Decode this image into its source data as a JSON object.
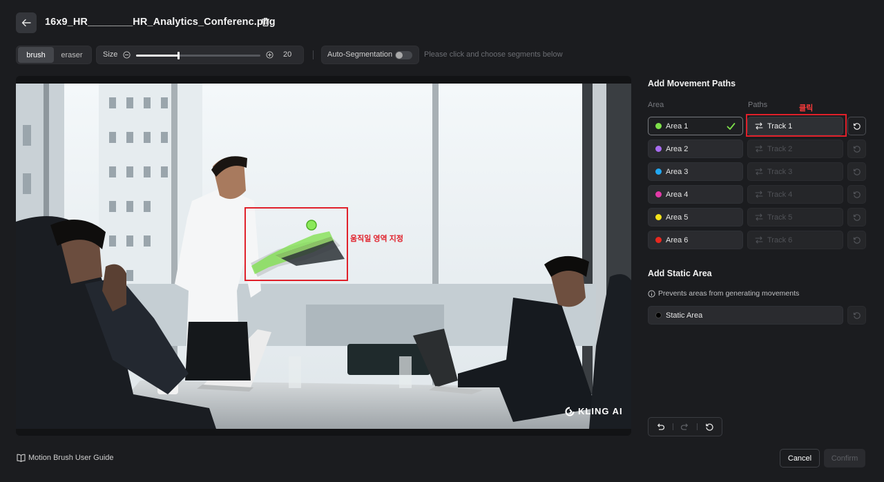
{
  "header": {
    "file_name": "16x9_HR________HR_Analytics_Conferenc.png"
  },
  "toolbar": {
    "brush_label": "brush",
    "eraser_label": "eraser",
    "size_label": "Size",
    "size_value": "20",
    "size_fraction": 0.34,
    "auto_seg_label": "Auto-Segmentation",
    "auto_seg_enabled": false,
    "hint": "Please click and choose segments below"
  },
  "canvas": {
    "watermark": "KLING AI",
    "annotation": "움직일 영역 지정"
  },
  "movement": {
    "title": "Add Movement Paths",
    "area_col": "Area",
    "paths_col": "Paths",
    "click_annotation": "클릭",
    "rows": [
      {
        "area": "Area 1",
        "track": "Track 1",
        "color": "#7ee04a",
        "active": true
      },
      {
        "area": "Area 2",
        "track": "Track 2",
        "color": "#a86cf0",
        "active": false
      },
      {
        "area": "Area 3",
        "track": "Track 3",
        "color": "#22a8f2",
        "active": false
      },
      {
        "area": "Area 4",
        "track": "Track 4",
        "color": "#e23aa7",
        "active": false
      },
      {
        "area": "Area 5",
        "track": "Track 5",
        "color": "#f2e21a",
        "active": false
      },
      {
        "area": "Area 6",
        "track": "Track 6",
        "color": "#e8281f",
        "active": false
      }
    ]
  },
  "static": {
    "title": "Add Static Area",
    "info": "Prevents areas from generating movements",
    "button": "Static Area",
    "color": "#000000"
  },
  "footer": {
    "guide": "Motion Brush User Guide",
    "cancel": "Cancel",
    "confirm": "Confirm"
  },
  "colors": {
    "accent_red": "#e0202a",
    "check_green": "#7ee04a"
  }
}
